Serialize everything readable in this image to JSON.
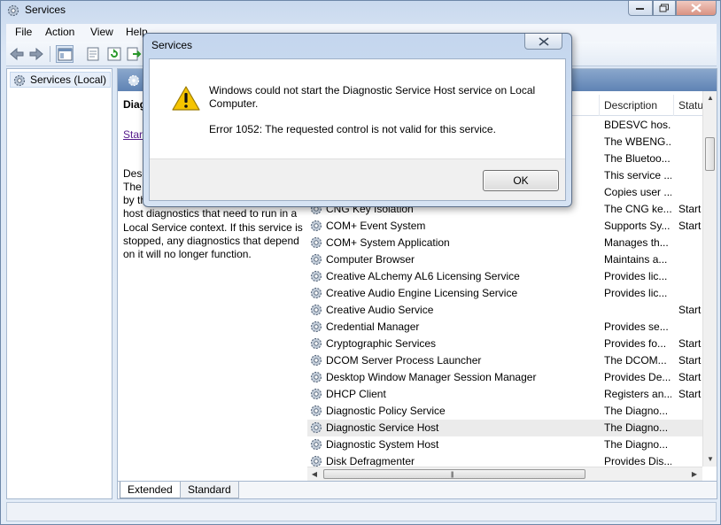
{
  "window": {
    "title": "Services"
  },
  "menu": [
    "File",
    "Action",
    "View",
    "Help"
  ],
  "tree": {
    "root_label": "Services (Local)"
  },
  "details": {
    "title": "Diag",
    "link": "Start",
    "label": "Desc",
    "lines": [
      "The",
      "by th",
      "host diagnostics that need to run in a",
      "Local Service context.  If this service is",
      "stopped, any diagnostics that depend",
      "on it will no longer function."
    ]
  },
  "columns": {
    "description": "Description",
    "status": "Statu"
  },
  "rows": [
    {
      "name": "",
      "description": "BDESVC hos...",
      "status": ""
    },
    {
      "name": "",
      "description": "The WBENG...",
      "status": ""
    },
    {
      "name": "",
      "description": "The Bluetoo...",
      "status": ""
    },
    {
      "name": "",
      "description": "This service ...",
      "status": ""
    },
    {
      "name": "",
      "description": "Copies user ...",
      "status": ""
    },
    {
      "name": "CNG Key Isolation",
      "description": "The CNG ke...",
      "status": "Start"
    },
    {
      "name": "COM+ Event System",
      "description": "Supports Sy...",
      "status": "Start"
    },
    {
      "name": "COM+ System Application",
      "description": "Manages th...",
      "status": ""
    },
    {
      "name": "Computer Browser",
      "description": "Maintains a...",
      "status": ""
    },
    {
      "name": "Creative ALchemy AL6 Licensing Service",
      "description": "Provides lic...",
      "status": ""
    },
    {
      "name": "Creative Audio Engine Licensing Service",
      "description": "Provides lic...",
      "status": ""
    },
    {
      "name": "Creative Audio Service",
      "description": "",
      "status": "Start"
    },
    {
      "name": "Credential Manager",
      "description": "Provides se...",
      "status": ""
    },
    {
      "name": "Cryptographic Services",
      "description": "Provides fo...",
      "status": "Start"
    },
    {
      "name": "DCOM Server Process Launcher",
      "description": "The DCOM...",
      "status": "Start"
    },
    {
      "name": "Desktop Window Manager Session Manager",
      "description": "Provides De...",
      "status": "Start"
    },
    {
      "name": "DHCP Client",
      "description": "Registers an...",
      "status": "Start"
    },
    {
      "name": "Diagnostic Policy Service",
      "description": "The Diagno...",
      "status": ""
    },
    {
      "name": "Diagnostic Service Host",
      "description": "The Diagno...",
      "status": "",
      "selected": true
    },
    {
      "name": "Diagnostic System Host",
      "description": "The Diagno...",
      "status": ""
    },
    {
      "name": "Disk Defragmenter",
      "description": "Provides Dis...",
      "status": ""
    }
  ],
  "tabs": {
    "extended": "Extended",
    "standard": "Standard"
  },
  "dialog": {
    "title": "Services",
    "message": "Windows could not start the Diagnostic Service Host service on Local Computer.",
    "error": "Error 1052: The requested control is not valid for this service.",
    "ok": "OK"
  },
  "colors": {
    "warning": "#f5c400",
    "header": "#6f90bf"
  }
}
